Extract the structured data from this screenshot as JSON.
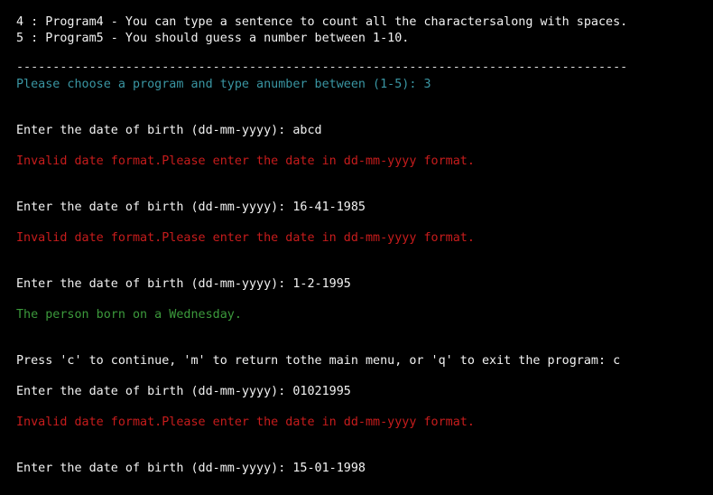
{
  "terminal": {
    "lines": {
      "menu_item_4": "4 : Program4 - You can type a sentence to count all the charactersalong with spaces.",
      "menu_item_5": "5 : Program5 - You should guess a number between 1-10.",
      "divider": "------------------------------------------------------------------------------------",
      "choose_prompt": "Please choose a program and type anumber between (1-5): 3",
      "dob_prompt_1": "Enter the date of birth (dd-mm-yyyy): abcd",
      "error_1": "Invalid date format.Please enter the date in dd-mm-yyyy format.",
      "dob_prompt_2": "Enter the date of birth (dd-mm-yyyy): 16-41-1985",
      "error_2": "Invalid date format.Please enter the date in dd-mm-yyyy format.",
      "dob_prompt_3": "Enter the date of birth (dd-mm-yyyy): 1-2-1995",
      "result": "The person born on a Wednesday.",
      "continue_prompt": "Press 'c' to continue, 'm' to return tothe main menu, or 'q' to exit the program: c",
      "dob_prompt_4": "Enter the date of birth (dd-mm-yyyy): 01021995",
      "error_3": "Invalid date format.Please enter the date in dd-mm-yyyy format.",
      "dob_prompt_5": "Enter the date of birth (dd-mm-yyyy): 15-01-1998"
    },
    "colors": {
      "background": "#000000",
      "text": "#f2f2f2",
      "prompt": "#3a96a3",
      "error": "#c71c1c",
      "success": "#3c9a3c"
    }
  }
}
